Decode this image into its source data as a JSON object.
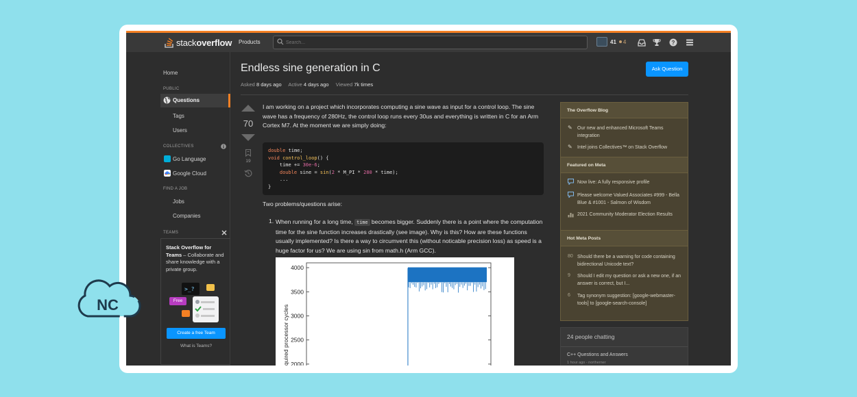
{
  "brand": {
    "logo_plain": "stack",
    "logo_bold": "overflow"
  },
  "topbar": {
    "products": "Products",
    "search_placeholder": "Search...",
    "reputation": "41",
    "bronze_badges": "4"
  },
  "nav": {
    "home": "Home",
    "public_head": "PUBLIC",
    "questions": "Questions",
    "tags": "Tags",
    "users": "Users",
    "collectives_head": "COLLECTIVES",
    "collectives": [
      "Go Language",
      "Google Cloud"
    ],
    "find_job_head": "FIND A JOB",
    "jobs": "Jobs",
    "companies": "Companies",
    "teams_head": "TEAMS",
    "teams_title": "Stack Overflow for Teams",
    "teams_desc": " – Collaborate and share knowledge with a private group.",
    "free_label": "Free",
    "create_team": "Create a free Team",
    "what_is_teams": "What is Teams?"
  },
  "question": {
    "title": "Endless sine generation in C",
    "ask_button": "Ask Question",
    "asked_label": "Asked",
    "asked_value": "8 days ago",
    "active_label": "Active",
    "active_value": "4 days ago",
    "viewed_label": "Viewed",
    "viewed_value": "7k times",
    "votes": "70",
    "bookmarks": "19",
    "intro": "I am working on a project which incorporates computing a sine wave as input for a control loop. The sine wave has a frequency of 280Hz, the control loop runs every 30us and everything is written in C for an Arm Cortex M7. At the moment we are simply doing:",
    "code": {
      "line1_kw": "double",
      "line1_rest": " time;",
      "line2_kw": "void",
      "line2_fn": " control_loop",
      "line2_rest": "() {",
      "line3_pre": "    time += ",
      "line3_num": "30e-6",
      "line3_post": ";",
      "line4_kw": "    double",
      "line4_mid": " sine = ",
      "line4_fn": "sin",
      "line4_a": "(",
      "line4_n1": "2",
      "line4_b": " * M_PI * ",
      "line4_n2": "280",
      "line4_c": " * time);",
      "line5": "    ...",
      "line6": "}"
    },
    "problems": "Two problems/questions arise:",
    "item_number": "1.",
    "item_pre": "When running for a long time, ",
    "item_code": "time",
    "item_post": " becomes bigger. Suddenly there is a point where the computation time for the sine function increases drastically (see image). Why is this? How are these functions usually implemented? Is there a way to circumvent this (without noticable precision loss) as speed is a huge factor for us? We are using sin from math.h (Arm GCC)."
  },
  "chart_data": {
    "type": "line",
    "title": "",
    "xlabel": "",
    "ylabel": "quired processor cycles",
    "ylim": [
      1800,
      4100
    ],
    "yticks": [
      "4000",
      "3500",
      "3000",
      "2500",
      "2000"
    ],
    "series": [
      {
        "x": [
          0,
          0.55
        ],
        "values": [
          1900,
          1900
        ]
      },
      {
        "x": [
          0.55,
          1.0
        ],
        "values": [
          3950,
          3950
        ]
      }
    ],
    "colors": {
      "line": "#1c73c2"
    }
  },
  "sidebar": {
    "blog_head": "The Overflow Blog",
    "blog_items": [
      "Our new and enhanced Microsoft Teams integration",
      "Intel joins Collectives™ on Stack Overflow"
    ],
    "meta_head": "Featured on Meta",
    "meta_items": [
      "Now live: A fully responsive profile",
      "Please welcome Valued Associates #999 - Bella Blue & #1001 - Salmon of Wisdom",
      "2021 Community Moderator Election Results"
    ],
    "hot_head": "Hot Meta Posts",
    "hot_items": [
      {
        "num": "80",
        "text": "Should there be a warning for code containing bidirectional Unicode text?"
      },
      {
        "num": "9",
        "text": "Should I edit my question or ask a new one, if an answer is correct, but I..."
      },
      {
        "num": "6",
        "text": "Tag synonym suggestion: [google-webmaster-tools] to [google-search-console]"
      }
    ],
    "chat_title": "24 people chatting",
    "chat_room": "C++ Questions and Answers",
    "chat_sub": "1 hour ago - northerner"
  },
  "badge": {
    "text": "NC"
  },
  "colors": {
    "accent": "#f48024",
    "button": "#0a95ff",
    "background": "#8fe0ec"
  }
}
